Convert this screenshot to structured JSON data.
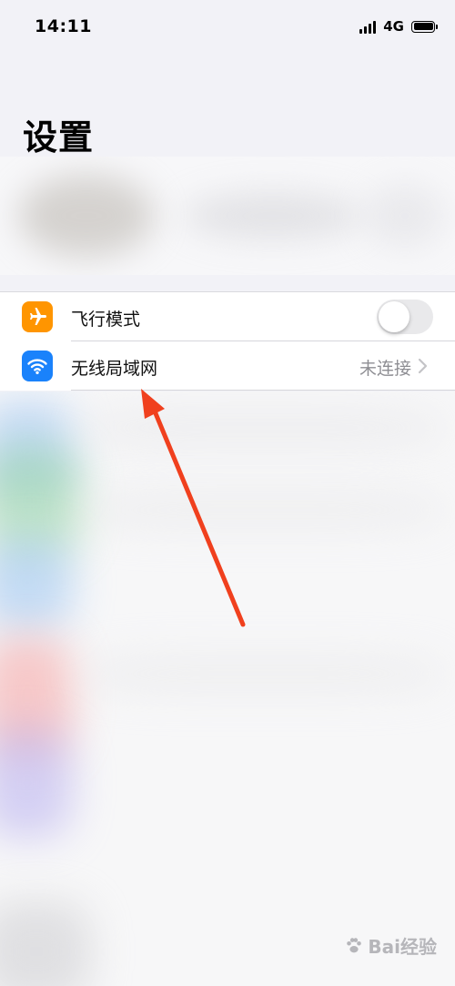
{
  "status_bar": {
    "time": "14:11",
    "network": "4G",
    "signal_icon": "signal-bars-icon",
    "battery_icon": "battery-icon"
  },
  "page": {
    "title": "设置"
  },
  "settings": {
    "items": [
      {
        "label": "飞行模式",
        "icon": "airplane-icon",
        "icon_color": "#ff9500",
        "control": "toggle",
        "toggle_on": false
      },
      {
        "label": "无线局域网",
        "icon": "wifi-icon",
        "icon_color": "#1a82fb",
        "value": "未连接",
        "control": "chevron"
      }
    ]
  },
  "annotation": {
    "arrow_color": "#f0401e"
  },
  "watermark": {
    "text": "Bai经验"
  }
}
